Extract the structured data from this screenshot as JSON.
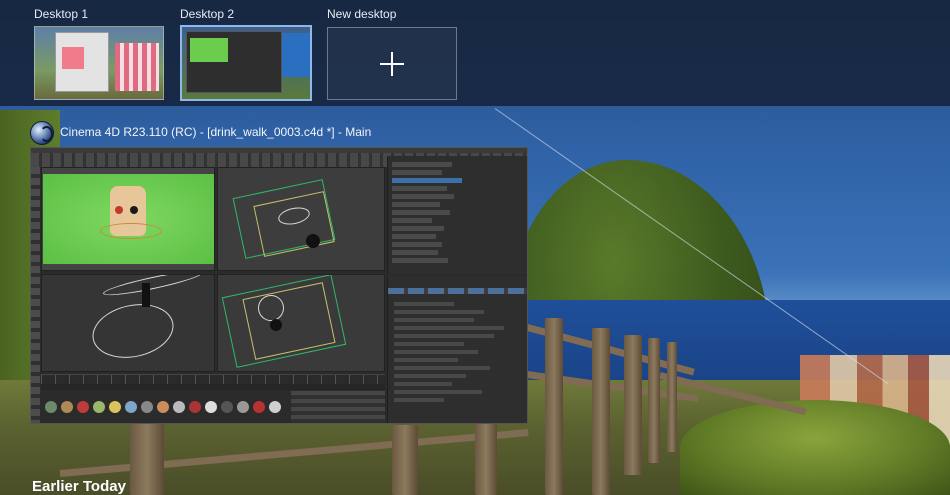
{
  "desktops": [
    {
      "label": "Desktop 1",
      "active": false
    },
    {
      "label": "Desktop 2",
      "active": true
    }
  ],
  "new_desktop": {
    "label": "New desktop",
    "icon": "plus-icon"
  },
  "window": {
    "title": "Cinema 4D R23.110 (RC) - [drink_walk_0003.c4d *] - Main",
    "icon": "cinema4d-icon"
  },
  "section": {
    "title": "Earlier Today"
  },
  "colors": {
    "accent_border": "#8fb8e8",
    "topbar_bg": "#142034",
    "viewport_green": "#6dc850"
  }
}
